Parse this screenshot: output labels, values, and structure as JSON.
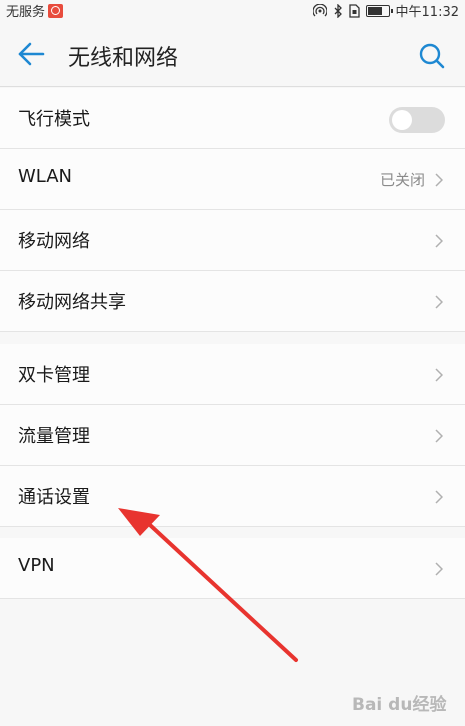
{
  "status_bar": {
    "carrier": "无服务",
    "time": "中午11:32"
  },
  "header": {
    "title": "无线和网络"
  },
  "groups": [
    {
      "items": [
        {
          "label": "飞行模式",
          "type": "toggle",
          "state": "off"
        },
        {
          "label": "WLAN",
          "value": "已关闭",
          "type": "link"
        },
        {
          "label": "移动网络",
          "type": "link"
        },
        {
          "label": "移动网络共享",
          "type": "link"
        }
      ]
    },
    {
      "items": [
        {
          "label": "双卡管理",
          "type": "link"
        },
        {
          "label": "流量管理",
          "type": "link"
        },
        {
          "label": "通话设置",
          "type": "link"
        }
      ]
    },
    {
      "items": [
        {
          "label": "VPN",
          "type": "link"
        }
      ]
    }
  ],
  "annotation": {
    "color": "#e8342f"
  },
  "watermark": {
    "text": "Bai du经验"
  },
  "icons": [
    "back-arrow-icon",
    "search-icon",
    "chevron-right-icon"
  ],
  "colors": {
    "accent": "#1e88d2",
    "background": "#f7f7f7",
    "divider": "#e4e4e4"
  }
}
